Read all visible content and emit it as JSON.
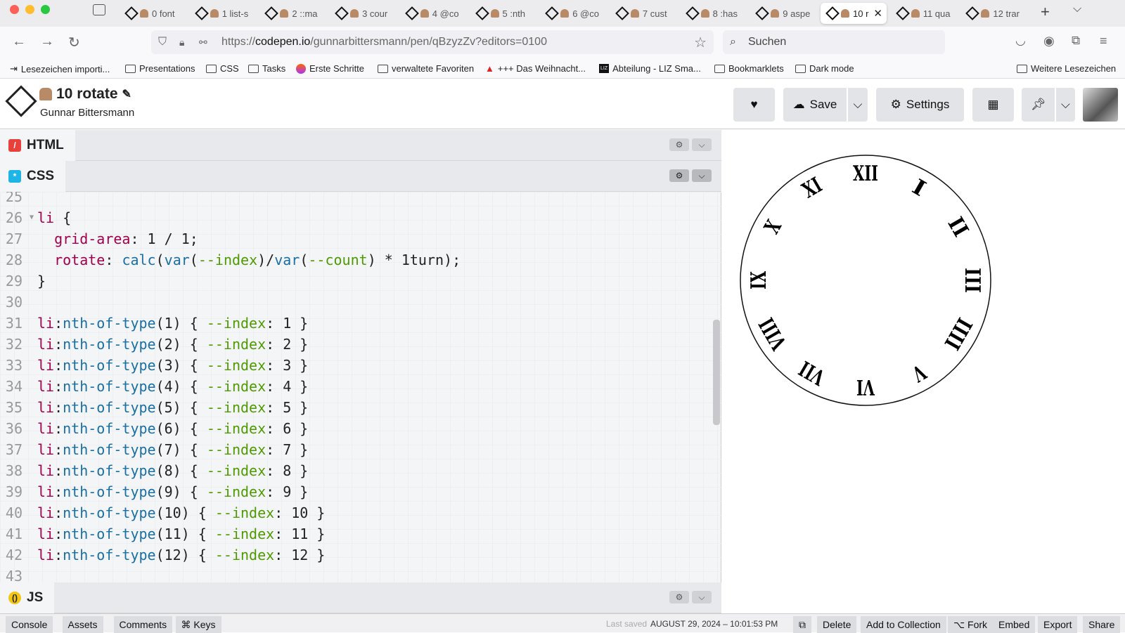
{
  "browser": {
    "tabs": [
      "0 font",
      "1 list-s",
      "2 ::ma",
      "3 cour",
      "4 @co",
      "5 :nth",
      "6 @co",
      "7 cust",
      "8 :has",
      "9 aspe",
      "10 r",
      "11 qua",
      "12 trar"
    ],
    "active_tab": 10,
    "url_prefix": "https://",
    "url_domain": "codepen.io",
    "url_path": "/gunnarbittersmann/pen/qBzyzZv?editors=0100",
    "search_placeholder": "Suchen",
    "bookmarks": [
      "Lesezeichen importi...",
      "Presentations",
      "CSS",
      "Tasks",
      "Erste Schritte",
      "verwaltete Favoriten",
      "+++ Das Weihnacht...",
      "Abteilung - LIZ Sma...",
      "Bookmarklets",
      "Dark mode"
    ],
    "more_bookmarks": "Weitere Lesezeichen"
  },
  "pen": {
    "title": "10 rotate",
    "author": "Gunnar Bittersmann",
    "save": "Save",
    "settings": "Settings"
  },
  "panels": {
    "html": "HTML",
    "css": "CSS",
    "js": "JS"
  },
  "code": [
    {
      "n": "25",
      "t": []
    },
    {
      "n": "26",
      "fold": true,
      "t": [
        [
          "sel",
          "li"
        ],
        [
          "pun",
          " {"
        ]
      ]
    },
    {
      "n": "27",
      "t": [
        [
          "pun",
          "  "
        ],
        [
          "prop",
          "grid-area"
        ],
        [
          "pun",
          ": 1 / 1;"
        ]
      ]
    },
    {
      "n": "28",
      "t": [
        [
          "pun",
          "  "
        ],
        [
          "prop",
          "rotate"
        ],
        [
          "pun",
          ": "
        ],
        [
          "fn",
          "calc"
        ],
        [
          "pun",
          "("
        ],
        [
          "fn",
          "var"
        ],
        [
          "pun",
          "("
        ],
        [
          "var",
          "--index"
        ],
        [
          "pun",
          ")/"
        ],
        [
          "fn",
          "var"
        ],
        [
          "pun",
          "("
        ],
        [
          "var",
          "--count"
        ],
        [
          "pun",
          ") * 1turn);"
        ]
      ]
    },
    {
      "n": "29",
      "t": [
        [
          "pun",
          "}"
        ]
      ]
    },
    {
      "n": "30",
      "t": []
    },
    {
      "n": "31",
      "t": [
        [
          "sel",
          "li"
        ],
        [
          "pun",
          ":"
        ],
        [
          "fn",
          "nth-of-type"
        ],
        [
          "pun",
          "(1) { "
        ],
        [
          "var",
          "--index"
        ],
        [
          "pun",
          ": 1 }"
        ]
      ]
    },
    {
      "n": "32",
      "t": [
        [
          "sel",
          "li"
        ],
        [
          "pun",
          ":"
        ],
        [
          "fn",
          "nth-of-type"
        ],
        [
          "pun",
          "(2) { "
        ],
        [
          "var",
          "--index"
        ],
        [
          "pun",
          ": 2 }"
        ]
      ]
    },
    {
      "n": "33",
      "t": [
        [
          "sel",
          "li"
        ],
        [
          "pun",
          ":"
        ],
        [
          "fn",
          "nth-of-type"
        ],
        [
          "pun",
          "(3) { "
        ],
        [
          "var",
          "--index"
        ],
        [
          "pun",
          ": 3 }"
        ]
      ]
    },
    {
      "n": "34",
      "t": [
        [
          "sel",
          "li"
        ],
        [
          "pun",
          ":"
        ],
        [
          "fn",
          "nth-of-type"
        ],
        [
          "pun",
          "(4) { "
        ],
        [
          "var",
          "--index"
        ],
        [
          "pun",
          ": 4 }"
        ]
      ]
    },
    {
      "n": "35",
      "t": [
        [
          "sel",
          "li"
        ],
        [
          "pun",
          ":"
        ],
        [
          "fn",
          "nth-of-type"
        ],
        [
          "pun",
          "(5) { "
        ],
        [
          "var",
          "--index"
        ],
        [
          "pun",
          ": 5 }"
        ]
      ]
    },
    {
      "n": "36",
      "t": [
        [
          "sel",
          "li"
        ],
        [
          "pun",
          ":"
        ],
        [
          "fn",
          "nth-of-type"
        ],
        [
          "pun",
          "(6) { "
        ],
        [
          "var",
          "--index"
        ],
        [
          "pun",
          ": 6 }"
        ]
      ]
    },
    {
      "n": "37",
      "t": [
        [
          "sel",
          "li"
        ],
        [
          "pun",
          ":"
        ],
        [
          "fn",
          "nth-of-type"
        ],
        [
          "pun",
          "(7) { "
        ],
        [
          "var",
          "--index"
        ],
        [
          "pun",
          ": 7 }"
        ]
      ]
    },
    {
      "n": "38",
      "t": [
        [
          "sel",
          "li"
        ],
        [
          "pun",
          ":"
        ],
        [
          "fn",
          "nth-of-type"
        ],
        [
          "pun",
          "(8) { "
        ],
        [
          "var",
          "--index"
        ],
        [
          "pun",
          ": 8 }"
        ]
      ]
    },
    {
      "n": "39",
      "t": [
        [
          "sel",
          "li"
        ],
        [
          "pun",
          ":"
        ],
        [
          "fn",
          "nth-of-type"
        ],
        [
          "pun",
          "(9) { "
        ],
        [
          "var",
          "--index"
        ],
        [
          "pun",
          ": 9 }"
        ]
      ]
    },
    {
      "n": "40",
      "t": [
        [
          "sel",
          "li"
        ],
        [
          "pun",
          ":"
        ],
        [
          "fn",
          "nth-of-type"
        ],
        [
          "pun",
          "(10) { "
        ],
        [
          "var",
          "--index"
        ],
        [
          "pun",
          ": 10 }"
        ]
      ]
    },
    {
      "n": "41",
      "t": [
        [
          "sel",
          "li"
        ],
        [
          "pun",
          ":"
        ],
        [
          "fn",
          "nth-of-type"
        ],
        [
          "pun",
          "(11) { "
        ],
        [
          "var",
          "--index"
        ],
        [
          "pun",
          ": 11 }"
        ]
      ]
    },
    {
      "n": "42",
      "t": [
        [
          "sel",
          "li"
        ],
        [
          "pun",
          ":"
        ],
        [
          "fn",
          "nth-of-type"
        ],
        [
          "pun",
          "(12) { "
        ],
        [
          "var",
          "--index"
        ],
        [
          "pun",
          ": 12 }"
        ]
      ]
    },
    {
      "n": "43",
      "t": []
    }
  ],
  "clock": {
    "numerals": [
      "I",
      "II",
      "III",
      "IIII",
      "V",
      "VI",
      "VII",
      "VIII",
      "IX",
      "X",
      "XI",
      "XII"
    ]
  },
  "footer": {
    "left": [
      "Console",
      "Assets",
      "Comments",
      "⌘ Keys"
    ],
    "last_saved_label": "Last saved",
    "last_saved_value": "AUGUST 29, 2024 – 10:01:53 PM",
    "right": [
      "Delete",
      "Add to Collection",
      "⌥ Fork",
      "Embed",
      "Export",
      "Share"
    ]
  }
}
